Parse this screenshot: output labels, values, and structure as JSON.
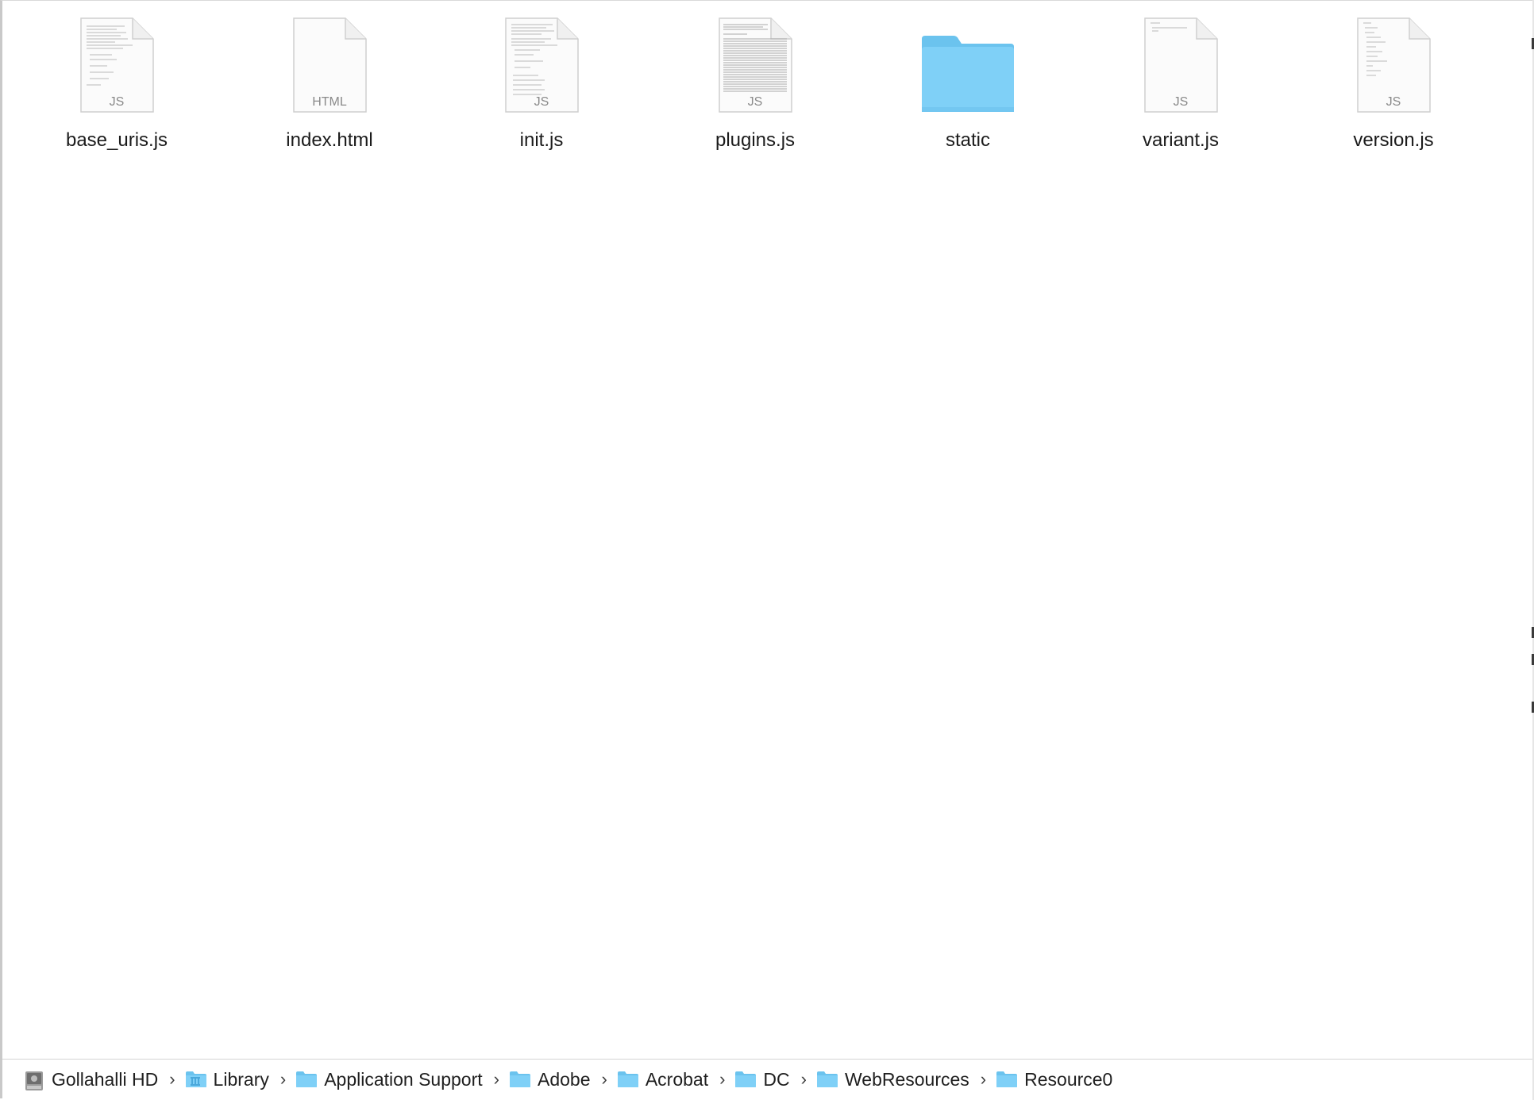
{
  "files": [
    {
      "name": "base_uris.js",
      "kind": "JS",
      "icon": "js-document-icon"
    },
    {
      "name": "index.html",
      "kind": "HTML",
      "icon": "html-document-icon"
    },
    {
      "name": "init.js",
      "kind": "JS",
      "icon": "js-document-icon"
    },
    {
      "name": "plugins.js",
      "kind": "JS",
      "icon": "js-document-icon"
    },
    {
      "name": "static",
      "kind": "",
      "icon": "folder-icon"
    },
    {
      "name": "variant.js",
      "kind": "JS",
      "icon": "js-document-icon"
    },
    {
      "name": "version.js",
      "kind": "JS",
      "icon": "js-document-icon"
    }
  ],
  "pathbar": {
    "items": [
      {
        "label": "Gollahalli HD",
        "icon": "hard-drive-icon"
      },
      {
        "label": "Library",
        "icon": "library-folder-icon"
      },
      {
        "label": "Application Support",
        "icon": "folder-icon"
      },
      {
        "label": "Adobe",
        "icon": "folder-icon"
      },
      {
        "label": "Acrobat",
        "icon": "folder-icon"
      },
      {
        "label": "DC",
        "icon": "folder-icon"
      },
      {
        "label": "WebResources",
        "icon": "folder-icon"
      },
      {
        "label": "Resource0",
        "icon": "folder-icon"
      }
    ],
    "separator": "›"
  },
  "colors": {
    "folder": "#7fd0f7",
    "folder_tab": "#6bc3ee",
    "doc_fill": "#fbfbfb",
    "doc_edge": "#cfcfcf",
    "badge_text": "#8a8a8a"
  }
}
